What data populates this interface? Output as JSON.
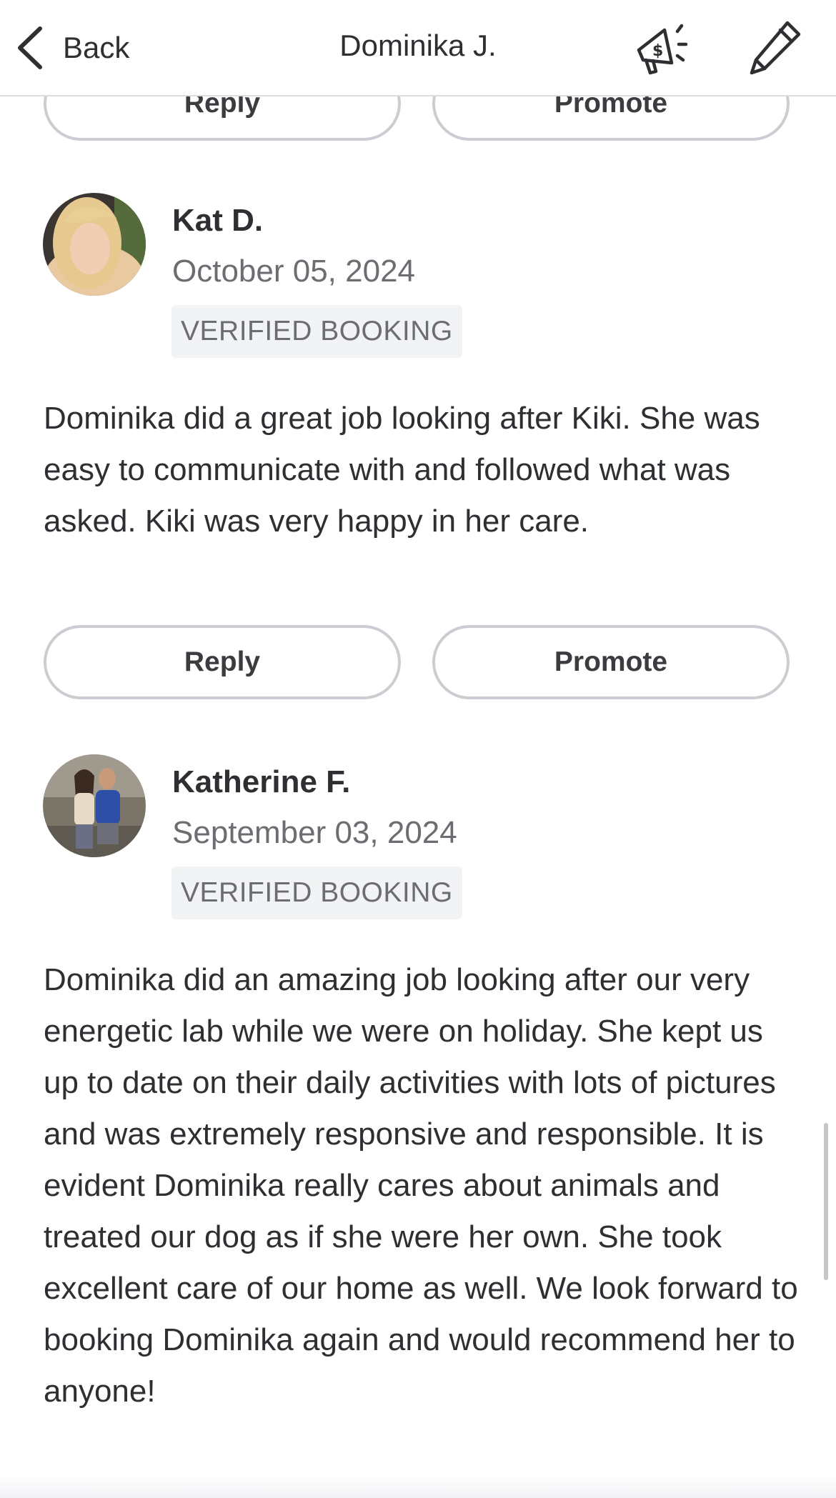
{
  "header": {
    "back_label": "Back",
    "title": "Dominika J.",
    "promote_icon": "megaphone-dollar-icon",
    "edit_icon": "pencil-icon"
  },
  "buttons": {
    "reply_label": "Reply",
    "promote_label": "Promote"
  },
  "reviews": [
    {
      "name": "Kat D.",
      "date": "October 05, 2024",
      "badge": "VERIFIED BOOKING",
      "text": "Dominika did a great job looking after Kiki. She was easy to communicate with and followed what was asked. Kiki was very happy in her care."
    },
    {
      "name": "Katherine F.",
      "date": "September 03, 2024",
      "badge": "VERIFIED BOOKING",
      "text": "Dominika did an amazing job looking after our very energetic lab while we were on holiday. She kept us up to date on their daily activities with lots of pictures and was extremely responsive and responsible. It is evident Dominika really cares about animals and treated our dog as if she were her own. She took excellent care of our home as well. We look forward to booking Dominika again and would recommend her to anyone!"
    }
  ],
  "colors": {
    "text": "#2f2f33",
    "muted": "#6c6d72",
    "button_border": "#cbcdd2",
    "badge_bg": "#f2f3f4"
  }
}
